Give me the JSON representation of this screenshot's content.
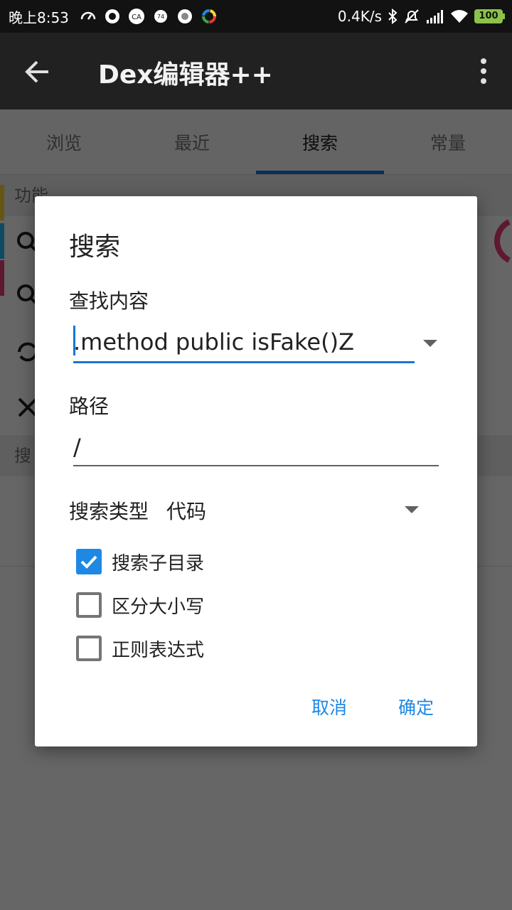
{
  "status_bar": {
    "time": "晚上8:53",
    "net_speed": "0.4K/s",
    "battery": "100"
  },
  "app_bar": {
    "title": "Dex编辑器++",
    "back_icon": "arrow-left-icon",
    "menu_icon": "more-vert-icon"
  },
  "tabs": [
    {
      "label": "浏览"
    },
    {
      "label": "最近"
    },
    {
      "label": "搜索"
    },
    {
      "label": "常量"
    }
  ],
  "active_tab": "搜索",
  "background": {
    "section1_label": "功能",
    "section2_label": "搜"
  },
  "dialog": {
    "title": "搜索",
    "find_label": "查找内容",
    "find_value": ".method public isFake()Z",
    "path_label": "路径",
    "path_value": "/",
    "type_label": "搜索类型",
    "type_value": "代码",
    "options": [
      {
        "label": "搜索子目录",
        "checked": true
      },
      {
        "label": "区分大小写",
        "checked": false
      },
      {
        "label": "正则表达式",
        "checked": false
      }
    ],
    "cancel_label": "取消",
    "ok_label": "确定"
  },
  "colors": {
    "accent": "#1e88e5",
    "app_bar": "#212121",
    "status_bar": "#121212"
  }
}
